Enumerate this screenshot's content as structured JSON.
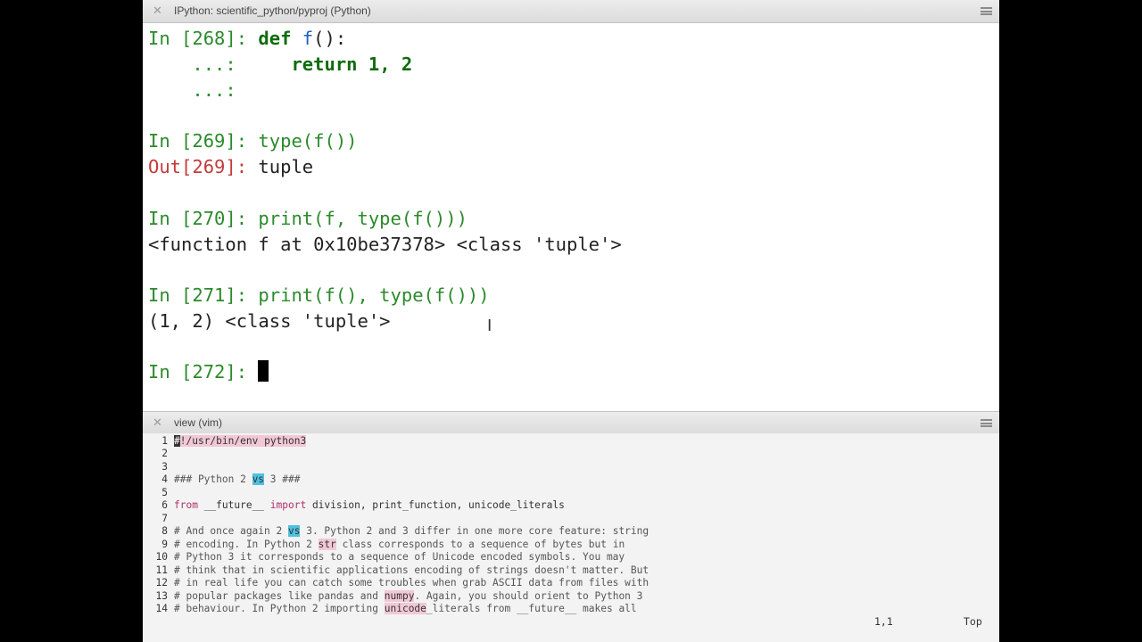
{
  "top_pane": {
    "title": "IPython: scientific_python/pyproj (Python)",
    "lines": [
      {
        "prompt": "In [268]: ",
        "code_kw": "def",
        "code_fn": "f",
        "code_rest": "():"
      },
      {
        "cont": "    ...: ",
        "code": "    return 1, 2"
      },
      {
        "cont": "    ...: ",
        "code": ""
      },
      {
        "prompt": "In [269]: ",
        "code": "type(f())"
      },
      {
        "out_prompt": "Out[269]: ",
        "text": "tuple"
      },
      {
        "prompt": "In [270]: ",
        "code": "print(f, type(f()))"
      },
      {
        "text": "<function f at 0x10be37378> <class 'tuple'>"
      },
      {
        "prompt": "In [271]: ",
        "code": "print(f(), type(f()))"
      },
      {
        "text": "(1, 2) <class 'tuple'>"
      },
      {
        "prompt": "In [272]: ",
        "code": ""
      }
    ]
  },
  "bottom_pane": {
    "title": "view (vim)",
    "status_position": "1,1",
    "status_scroll": "Top",
    "lines": [
      {
        "n": "1",
        "parts": [
          "#",
          "!/usr/bin/",
          "env",
          " ",
          "python3"
        ]
      },
      {
        "n": "2"
      },
      {
        "n": "3"
      },
      {
        "n": "4",
        "parts": [
          "### Python 2 ",
          "vs",
          " 3 ###"
        ]
      },
      {
        "n": "5"
      },
      {
        "n": "6",
        "parts": [
          "from",
          " __future__ ",
          "import",
          " division, print_function, unicode_literals"
        ]
      },
      {
        "n": "7"
      },
      {
        "n": "8",
        "parts": [
          "# And once again 2 ",
          "vs",
          " 3. Python 2 and 3 differ in one more core feature: string"
        ]
      },
      {
        "n": "9",
        "parts": [
          "# encoding. In Python 2 ",
          "str",
          " class corresponds to a sequence of bytes but in"
        ]
      },
      {
        "n": "10",
        "text": "# Python 3 it corresponds to a sequence of Unicode encoded symbols. You may"
      },
      {
        "n": "11",
        "text": "# think that in scientific applications encoding of strings doesn't matter. But"
      },
      {
        "n": "12",
        "text": "# in real life you can catch some troubles when grab ASCII data from files with"
      },
      {
        "n": "13",
        "parts": [
          "# popular packages like pandas and ",
          "numpy",
          ". Again, you should orient to Python 3"
        ]
      },
      {
        "n": "14",
        "parts": [
          "# behaviour. In Python 2 importing ",
          "unicode",
          "_literals from __future__ makes all"
        ]
      }
    ]
  }
}
